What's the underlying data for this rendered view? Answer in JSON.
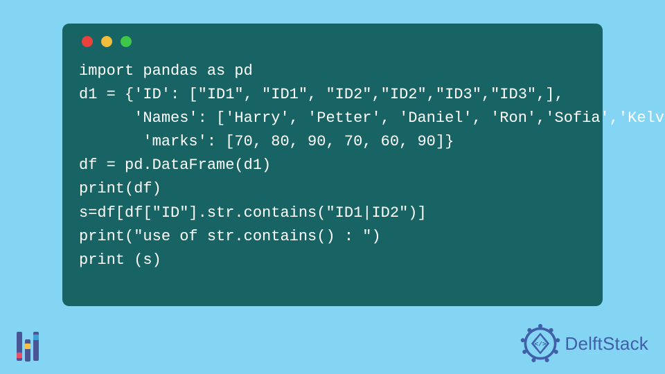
{
  "code": {
    "lines": [
      "import pandas as pd",
      "d1 = {'ID': [\"ID1\", \"ID1\", \"ID2\",\"ID2\",\"ID3\",\"ID3\",],",
      "      'Names': ['Harry', 'Petter', 'Daniel', 'Ron','Sofia','Kelvin'],",
      "       'marks': [70, 80, 90, 70, 60, 90]}",
      "df = pd.DataFrame(d1)",
      "print(df)",
      "s=df[df[\"ID\"].str.contains(\"ID1|ID2\")]",
      "print(\"use of str.contains() : \")",
      "print (s)"
    ]
  },
  "brand": {
    "name": "DelftStack"
  }
}
